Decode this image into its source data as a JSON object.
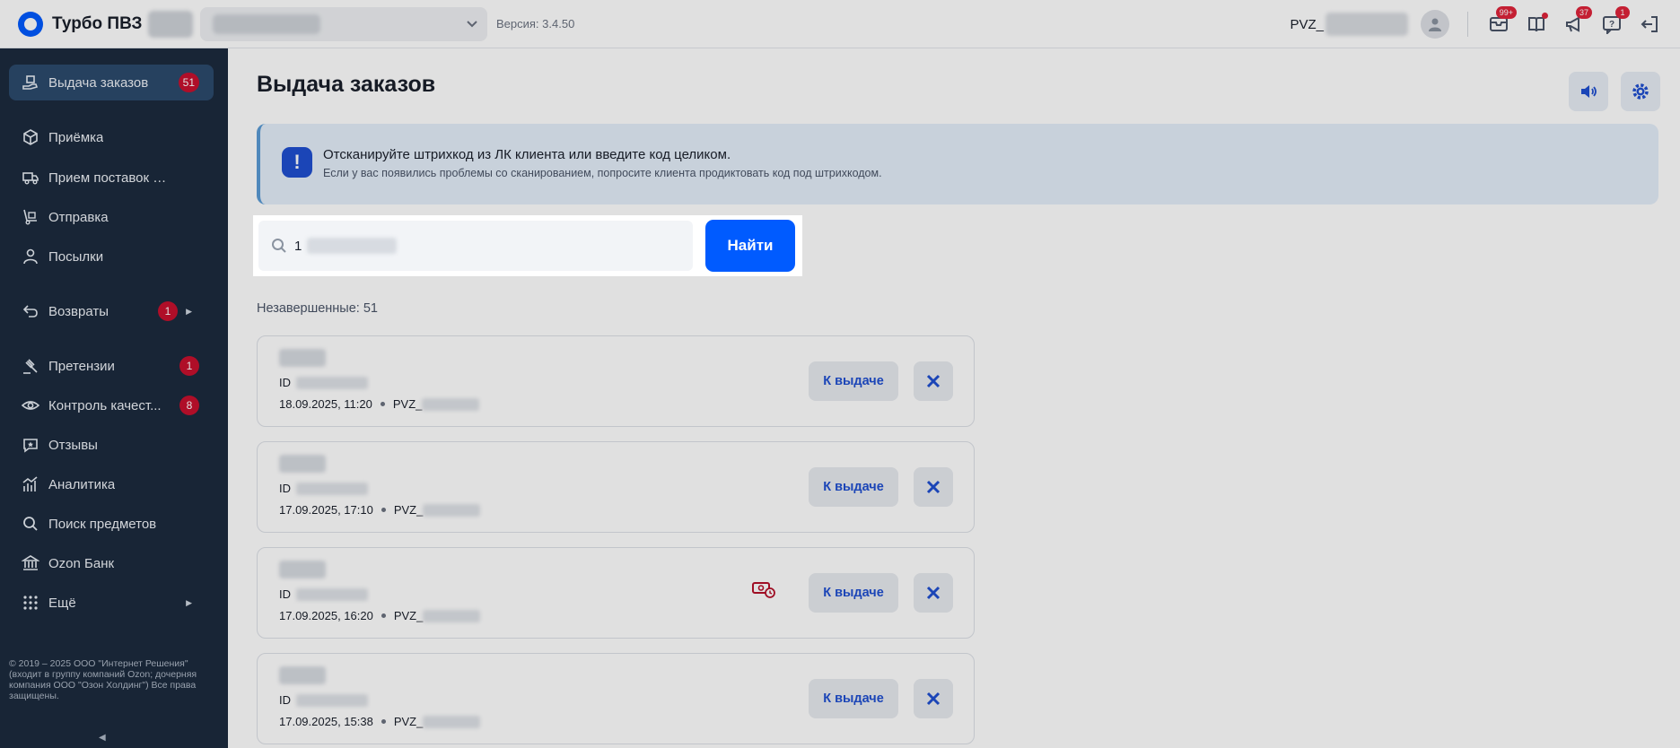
{
  "brand": {
    "name": "Турбо ПВЗ"
  },
  "header": {
    "version": "Версия: 3.4.50",
    "pvz_prefix": "PVZ_",
    "icons": [
      {
        "name": "messages-icon",
        "badge": "99+"
      },
      {
        "name": "book-icon",
        "badge": ""
      },
      {
        "name": "megaphone-icon",
        "badge": "37"
      },
      {
        "name": "help-icon",
        "badge": "1"
      },
      {
        "name": "logout-icon",
        "badge": ""
      }
    ]
  },
  "sidebar": {
    "items": [
      {
        "label": "Выдача заказов",
        "badge": "51",
        "icon": "hand-box-icon",
        "active": true
      },
      {
        "label": "Приёмка",
        "badge": "",
        "icon": "box-icon"
      },
      {
        "label": "Прием поставок FBO",
        "badge": "",
        "icon": "truck-icon"
      },
      {
        "label": "Отправка",
        "badge": "",
        "icon": "dolly-icon"
      },
      {
        "label": "Посылки",
        "badge": "",
        "icon": "user-icon"
      },
      {
        "label": "Возвраты",
        "badge": "1",
        "icon": "return-icon",
        "arrow": true
      },
      {
        "label": "Претензии",
        "badge": "1",
        "icon": "gavel-icon"
      },
      {
        "label": "Контроль качест...",
        "badge": "8",
        "icon": "eye-icon"
      },
      {
        "label": "Отзывы",
        "badge": "",
        "icon": "review-icon"
      },
      {
        "label": "Аналитика",
        "badge": "",
        "icon": "analytics-icon"
      },
      {
        "label": "Поиск предметов",
        "badge": "",
        "icon": "search-icon"
      },
      {
        "label": "Ozon Банк",
        "badge": "",
        "icon": "bank-icon"
      },
      {
        "label": "Ещё",
        "badge": "",
        "icon": "grid-icon",
        "arrow": true
      }
    ],
    "footer": "© 2019 – 2025 ООО \"Интернет Решения\" (входит в группу компаний Ozon; дочерняя компания ООО \"Озон Холдинг\") Все права защищены."
  },
  "main": {
    "title": "Выдача заказов",
    "banner": {
      "title": "Отсканируйте штрихкод из ЛК клиента или введите код целиком.",
      "subtitle": "Если у вас появились проблемы со сканированием, попросите клиента продиктовать код под штрихкодом."
    },
    "search": {
      "value": "1",
      "button": "Найти"
    },
    "unfinished": "Незавершенные: 51",
    "orders": [
      {
        "id_prefix": "ID",
        "datetime": "18.09.2025, 11:20",
        "pvz": "PVZ_",
        "issue_label": "К выдаче",
        "money_icon": false
      },
      {
        "id_prefix": "ID",
        "datetime": "17.09.2025, 17:10",
        "pvz": "PVZ_",
        "issue_label": "К выдаче",
        "money_icon": false
      },
      {
        "id_prefix": "ID",
        "datetime": "17.09.2025, 16:20",
        "pvz": "PVZ_",
        "issue_label": "К выдаче",
        "money_icon": true
      },
      {
        "id_prefix": "ID",
        "datetime": "17.09.2025, 15:38",
        "pvz": "PVZ_",
        "issue_label": "К выдаче",
        "money_icon": false
      }
    ]
  },
  "colors": {
    "accent": "#005bff",
    "sidebar": "#1c2b3e",
    "badge": "#c8102e"
  }
}
